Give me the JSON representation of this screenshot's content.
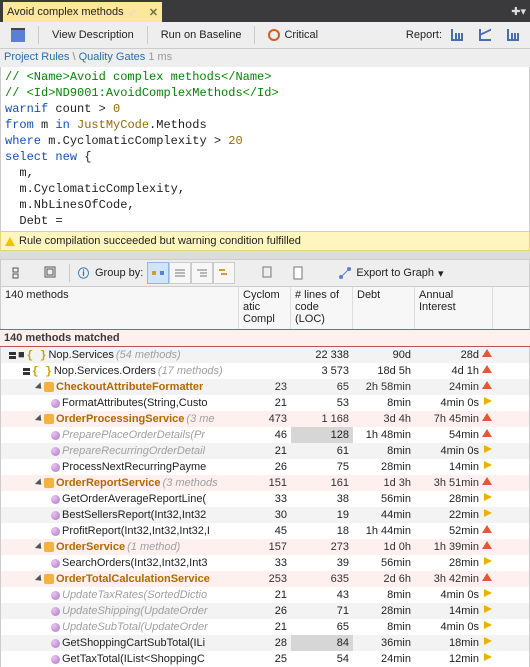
{
  "tab_title": "Avoid complex methods",
  "toolbar": {
    "view_desc": "View Description",
    "run_baseline": "Run on Baseline",
    "critical": "Critical",
    "report": "Report:"
  },
  "breadcrumbs": {
    "a": "Project Rules",
    "b": "Quality Gates"
  },
  "timing": "1 ms",
  "code": {
    "l1a": "// <Name>",
    "l1b": "Avoid complex methods",
    "l1c": "</Name>",
    "l2a": "// <Id>",
    "l2b": "ND9001:AvoidComplexMethods",
    "l2c": "</Id>",
    "l3a": "warnif",
    "l3b": " count > ",
    "l3c": "0",
    "l4a": "from",
    "l4b": " m ",
    "l4c": "in",
    "l4d": " JustMyCode",
    "l4e": ".Methods",
    "l5a": "where",
    "l5b": " m.CyclomaticComplexity > ",
    "l5c": "20",
    "l6a": "select",
    "l6b": " new",
    "l6c": " {",
    "l7": "  m,",
    "l8": "  m.CyclomaticComplexity,",
    "l9": "  m.NbLinesOfCode,",
    "l10": "  Debt ="
  },
  "status": "Rule compilation succeeded but warning condition fulfilled",
  "resultsbar": {
    "group_by": "Group by:",
    "export": "Export to Graph"
  },
  "count_label": "140 methods",
  "headers": {
    "cyclo": "Cyclom atic Compl",
    "loc": "# lines of code (LOC)",
    "debt": "Debt",
    "ann": "Annual Interest"
  },
  "match_banner": "140 methods matched",
  "rows": [
    {
      "depth": 0,
      "kind": "ns",
      "name": "Nop.Services",
      "note": "(54 methods)",
      "cyclo": "",
      "loc": "22 338",
      "debt": "90d",
      "ann": "28d",
      "ai": "up",
      "cls": "odd"
    },
    {
      "depth": 1,
      "kind": "ns",
      "name": "Nop.Services.Orders",
      "note": "(17 methods)",
      "cyclo": "",
      "loc": "3 573",
      "debt": "18d 5h",
      "ann": "4d 1h",
      "ai": "up"
    },
    {
      "depth": 2,
      "kind": "cls",
      "name": "CheckoutAttributeFormatter",
      "note": "",
      "cyclo": "23",
      "loc": "65",
      "debt": "2h 58min",
      "ann": "24min",
      "ai": "up",
      "hl": true,
      "cls": "odd"
    },
    {
      "depth": 3,
      "kind": "meth",
      "name": "FormatAttributes(String,Custo",
      "cyclo": "21",
      "loc": "53",
      "debt": "8min",
      "ann": "4min 0s",
      "ai": "flat"
    },
    {
      "depth": 2,
      "kind": "cls",
      "name": "OrderProcessingService",
      "note": "(3 me",
      "cyclo": "473",
      "loc": "1 168",
      "debt": "3d 4h",
      "ann": "7h 45min",
      "ai": "up",
      "hl": true,
      "cls": "hot"
    },
    {
      "depth": 3,
      "kind": "meth",
      "name": "PreparePlaceOrderDetails(Pr",
      "cyclo": "46",
      "loc": "128",
      "locsel": true,
      "debt": "1h 48min",
      "ann": "54min",
      "ai": "up",
      "ghost": true
    },
    {
      "depth": 3,
      "kind": "meth",
      "name": "PrepareRecurringOrderDetail",
      "cyclo": "21",
      "loc": "61",
      "debt": "8min",
      "ann": "4min 0s",
      "ai": "flat",
      "ghost": true,
      "cls": "odd"
    },
    {
      "depth": 3,
      "kind": "meth",
      "name": "ProcessNextRecurringPayme",
      "cyclo": "26",
      "loc": "75",
      "debt": "28min",
      "ann": "14min",
      "ai": "flat"
    },
    {
      "depth": 2,
      "kind": "cls",
      "name": "OrderReportService",
      "note": "(3 methods",
      "cyclo": "151",
      "loc": "161",
      "debt": "1d 3h",
      "ann": "3h 51min",
      "ai": "up",
      "hl": true,
      "cls": "hot"
    },
    {
      "depth": 3,
      "kind": "meth",
      "name": "GetOrderAverageReportLine(",
      "cyclo": "33",
      "loc": "38",
      "debt": "56min",
      "ann": "28min",
      "ai": "flat"
    },
    {
      "depth": 3,
      "kind": "meth",
      "name": "BestSellersReport(Int32,Int32",
      "cyclo": "30",
      "loc": "19",
      "debt": "44min",
      "ann": "22min",
      "ai": "flat",
      "cls": "odd"
    },
    {
      "depth": 3,
      "kind": "meth",
      "name": "ProfitReport(Int32,Int32,Int32,I",
      "cyclo": "45",
      "loc": "18",
      "debt": "1h 44min",
      "ann": "52min",
      "ai": "up"
    },
    {
      "depth": 2,
      "kind": "cls",
      "name": "OrderService",
      "note": "(1 method)",
      "cyclo": "157",
      "loc": "273",
      "debt": "1d 0h",
      "ann": "1h 39min",
      "ai": "up",
      "hl": true,
      "cls": "hot"
    },
    {
      "depth": 3,
      "kind": "meth",
      "name": "SearchOrders(Int32,Int32,Int3",
      "cyclo": "33",
      "loc": "39",
      "debt": "56min",
      "ann": "28min",
      "ai": "flat"
    },
    {
      "depth": 2,
      "kind": "cls",
      "name": "OrderTotalCalculationService",
      "note": "",
      "cyclo": "253",
      "loc": "635",
      "debt": "2d 6h",
      "ann": "3h 42min",
      "ai": "up",
      "hl": true,
      "cls": "hot"
    },
    {
      "depth": 3,
      "kind": "meth",
      "name": "UpdateTaxRates(SortedDictio",
      "cyclo": "21",
      "loc": "43",
      "debt": "8min",
      "ann": "4min 0s",
      "ai": "flat",
      "ghost": true
    },
    {
      "depth": 3,
      "kind": "meth",
      "name": "UpdateShipping(UpdateOrder",
      "cyclo": "26",
      "loc": "71",
      "debt": "28min",
      "ann": "14min",
      "ai": "flat",
      "ghost": true,
      "cls": "odd"
    },
    {
      "depth": 3,
      "kind": "meth",
      "name": "UpdateSubTotal(UpdateOrder",
      "cyclo": "21",
      "loc": "65",
      "debt": "8min",
      "ann": "4min 0s",
      "ai": "flat",
      "ghost": true
    },
    {
      "depth": 3,
      "kind": "meth",
      "name": "GetShoppingCartSubTotal(ILi",
      "cyclo": "28",
      "loc": "84",
      "locsel": true,
      "debt": "36min",
      "ann": "18min",
      "ai": "flat",
      "cls": "odd"
    },
    {
      "depth": 3,
      "kind": "meth",
      "name": "GetTaxTotal(IList<ShoppingC",
      "cyclo": "25",
      "loc": "54",
      "debt": "24min",
      "ann": "12min",
      "ai": "flat"
    }
  ]
}
